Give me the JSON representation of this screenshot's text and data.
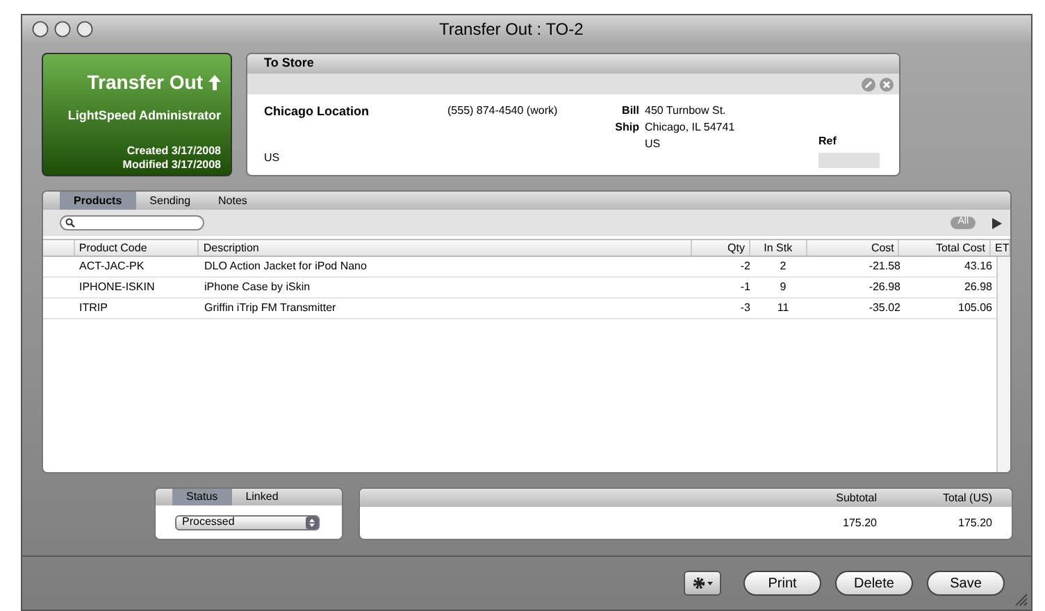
{
  "window": {
    "title": "Transfer Out : TO-2"
  },
  "header_card": {
    "title": "Transfer Out",
    "user": "LightSpeed Administrator",
    "created": "Created 3/17/2008",
    "modified": "Modified 3/17/2008"
  },
  "store": {
    "tab_label": "To Store",
    "name": "Chicago Location",
    "phone": "(555) 874-4540 (work)",
    "bill_label": "Bill",
    "ship_label": "Ship",
    "address": [
      "450 Turnbow St.",
      "Chicago, IL 54741",
      "US"
    ],
    "country": "US",
    "ref_label": "Ref"
  },
  "tabs": [
    {
      "label": "Products",
      "selected": true
    },
    {
      "label": "Sending",
      "selected": false
    },
    {
      "label": "Notes",
      "selected": false
    }
  ],
  "filter_button": "All",
  "table": {
    "columns": [
      "Product Code",
      "Description",
      "Qty",
      "In Stk",
      "Cost",
      "Total Cost",
      "ET"
    ],
    "rows": [
      [
        "ACT-JAC-PK",
        "DLO Action Jacket for iPod Nano",
        "-2",
        "2",
        "-21.58",
        "43.16"
      ],
      [
        "IPHONE-ISKIN",
        "iPhone Case by iSkin",
        "-1",
        "9",
        "-26.98",
        "26.98"
      ],
      [
        "ITRIP",
        "Griffin iTrip FM Transmitter",
        "-3",
        "11",
        "-35.02",
        "105.06"
      ]
    ]
  },
  "status_tabs": [
    {
      "label": "Status",
      "selected": true
    },
    {
      "label": "Linked",
      "selected": false
    }
  ],
  "status_select": "Processed",
  "totals": {
    "columns": [
      "Subtotal",
      "Total (US)"
    ],
    "values": [
      "175.20",
      "175.20"
    ]
  },
  "buttons": [
    "Print",
    "Delete",
    "Save"
  ]
}
